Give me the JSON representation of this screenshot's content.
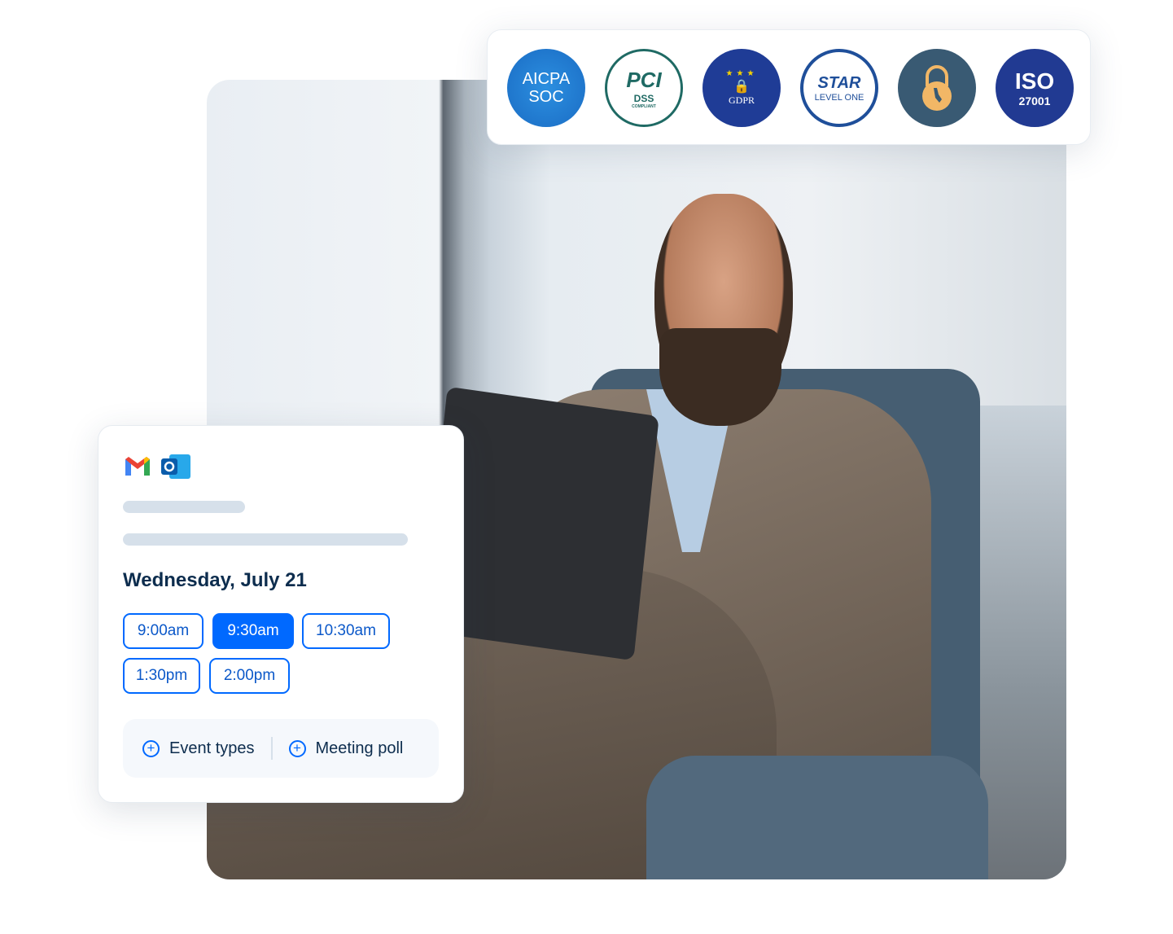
{
  "badges": {
    "aicpa": {
      "line1": "AICPA",
      "line2": "SOC"
    },
    "pci": {
      "line1": "PCI",
      "line2": "DSS",
      "line3": "COMPLIANT"
    },
    "gdpr": {
      "label": "GDPR"
    },
    "star": {
      "line1": "STAR",
      "line2": "LEVEL ONE"
    },
    "ccpa": {
      "icon": "lock-california-icon"
    },
    "iso": {
      "line1": "ISO",
      "line2": "27001"
    }
  },
  "card": {
    "integrations": [
      "gmail-icon",
      "outlook-icon"
    ],
    "date": "Wednesday, July 21",
    "slots": [
      {
        "label": "9:00am",
        "selected": false
      },
      {
        "label": "9:30am",
        "selected": true
      },
      {
        "label": "10:30am",
        "selected": false
      },
      {
        "label": "1:30pm",
        "selected": false
      },
      {
        "label": "2:00pm",
        "selected": false
      }
    ],
    "actions": {
      "event_types": "Event types",
      "meeting_poll": "Meeting poll"
    }
  },
  "colors": {
    "accent": "#0069ff",
    "heading": "#0d2d4e"
  }
}
